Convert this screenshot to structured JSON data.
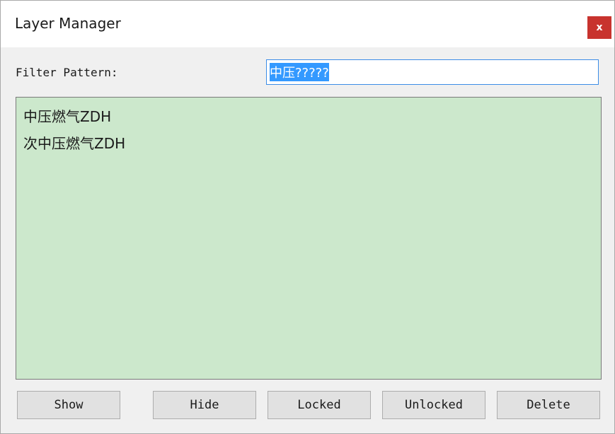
{
  "window": {
    "title": "Layer Manager",
    "close_label": "x"
  },
  "filter": {
    "label": "Filter Pattern:",
    "value_selected": "中压?????"
  },
  "layers": [
    "中压燃气ZDH",
    "次中压燃气ZDH"
  ],
  "buttons": {
    "show": "Show",
    "hide": "Hide",
    "locked": "Locked",
    "unlocked": "Unlocked",
    "delete": "Delete"
  },
  "colors": {
    "list_background": "#cce8cc",
    "close_button": "#c8332e",
    "selection": "#3399ff"
  }
}
